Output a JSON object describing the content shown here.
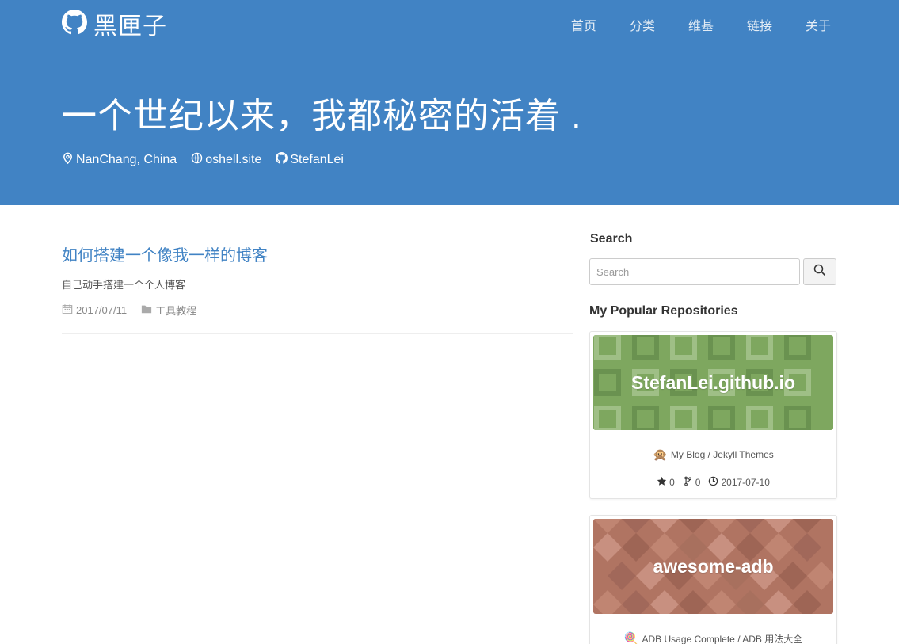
{
  "header": {
    "brand": "黑匣子",
    "nav": [
      "首页",
      "分类",
      "维基",
      "链接",
      "关于"
    ],
    "title": "一个世纪以来，我都秘密的活着 .",
    "meta": {
      "location": "NanChang, China",
      "website": "oshell.site",
      "github": "StefanLei"
    },
    "accent": "#4183c4"
  },
  "post": {
    "title": "如何搭建一个像我一样的博客",
    "excerpt": "自己动手搭建一个个人博客",
    "date": "2017/07/11",
    "category": "工具教程"
  },
  "sidebar": {
    "search_heading": "Search",
    "search_placeholder": "Search",
    "repos_heading": "My Popular Repositories",
    "repos": [
      {
        "name": "StefanLei.github.io",
        "emoji": "🙊",
        "description": "My Blog / Jekyll Themes",
        "stars": "0",
        "forks": "0",
        "updated": "2017-07-10",
        "color": "#7ea75f"
      },
      {
        "name": "awesome-adb",
        "emoji": "🍭",
        "description": "ADB Usage Complete / ADB 用法大全",
        "color": "#b07462"
      }
    ]
  }
}
